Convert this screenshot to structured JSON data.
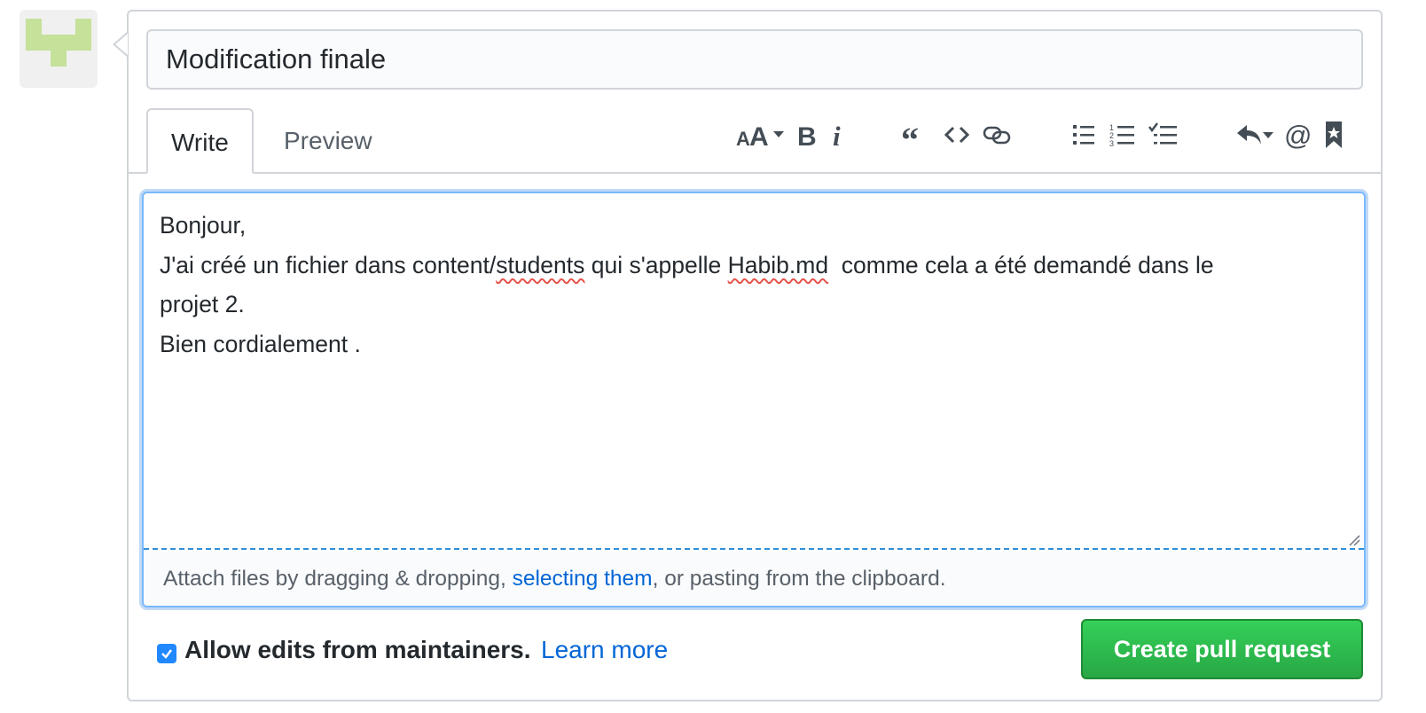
{
  "title_input": {
    "value": "Modification finale"
  },
  "tabs": [
    {
      "label": "Write"
    },
    {
      "label": "Preview"
    }
  ],
  "toolbar": {
    "icons": [
      "heading-icon",
      "bold-icon",
      "italic-icon",
      "quote-icon",
      "code-icon",
      "link-icon",
      "unordered-list-icon",
      "ordered-list-icon",
      "task-list-icon",
      "reply-icon",
      "mention-icon",
      "bookmark-icon"
    ]
  },
  "editor": {
    "lines": [
      "Bonjour,",
      "J'ai créé un fichier dans content/",
      "students",
      " qui s'appelle ",
      "Habib.md",
      "  comme cela a été demandé dans le",
      "projet 2.",
      "Bien cordialement ."
    ],
    "attach_prefix": "Attach files by dragging & dropping, ",
    "attach_link": "selecting them",
    "attach_suffix": ", or pasting from the clipboard."
  },
  "footer": {
    "allow_edits_label": "Allow edits from maintainers.",
    "allow_edits_checked": true,
    "learn_more": "Learn more",
    "create_button": "Create pull request"
  },
  "colors": {
    "primary_button": "#28a745",
    "link": "#0366d6",
    "focus_border": "#79b8ff",
    "avatar": "#c5e19a"
  }
}
